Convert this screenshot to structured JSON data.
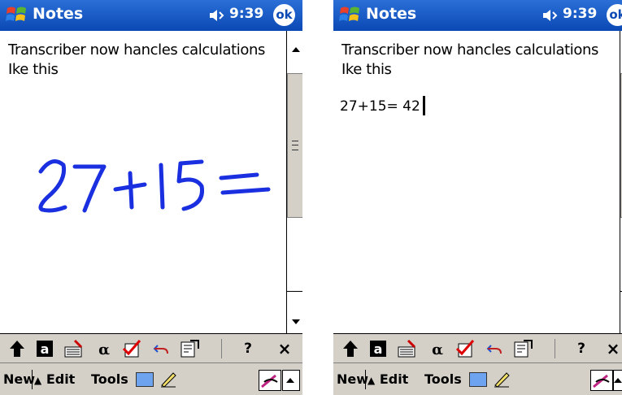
{
  "colors": {
    "titlebar": "#0b49b5",
    "ink": "#1a2fe0",
    "toolbar_bg": "#d4d0c8"
  },
  "screens": [
    {
      "title": "Notes",
      "time": "9:39",
      "ok_label": "ok",
      "note_text": "Transcriber now hancles calculations Ike this",
      "handwriting": "27+15=",
      "menu": {
        "new": "New",
        "edit": "Edit",
        "tools": "Tools"
      },
      "toolbar": {
        "help": "?",
        "close": "×"
      }
    },
    {
      "title": "Notes",
      "time": "9:39",
      "ok_label": "ok",
      "note_text": "Transcriber now hancles calculations Ike this",
      "typed_result": "27+15= 42",
      "menu": {
        "new": "New",
        "edit": "Edit",
        "tools": "Tools"
      },
      "toolbar": {
        "help": "?",
        "close": "×"
      }
    }
  ]
}
